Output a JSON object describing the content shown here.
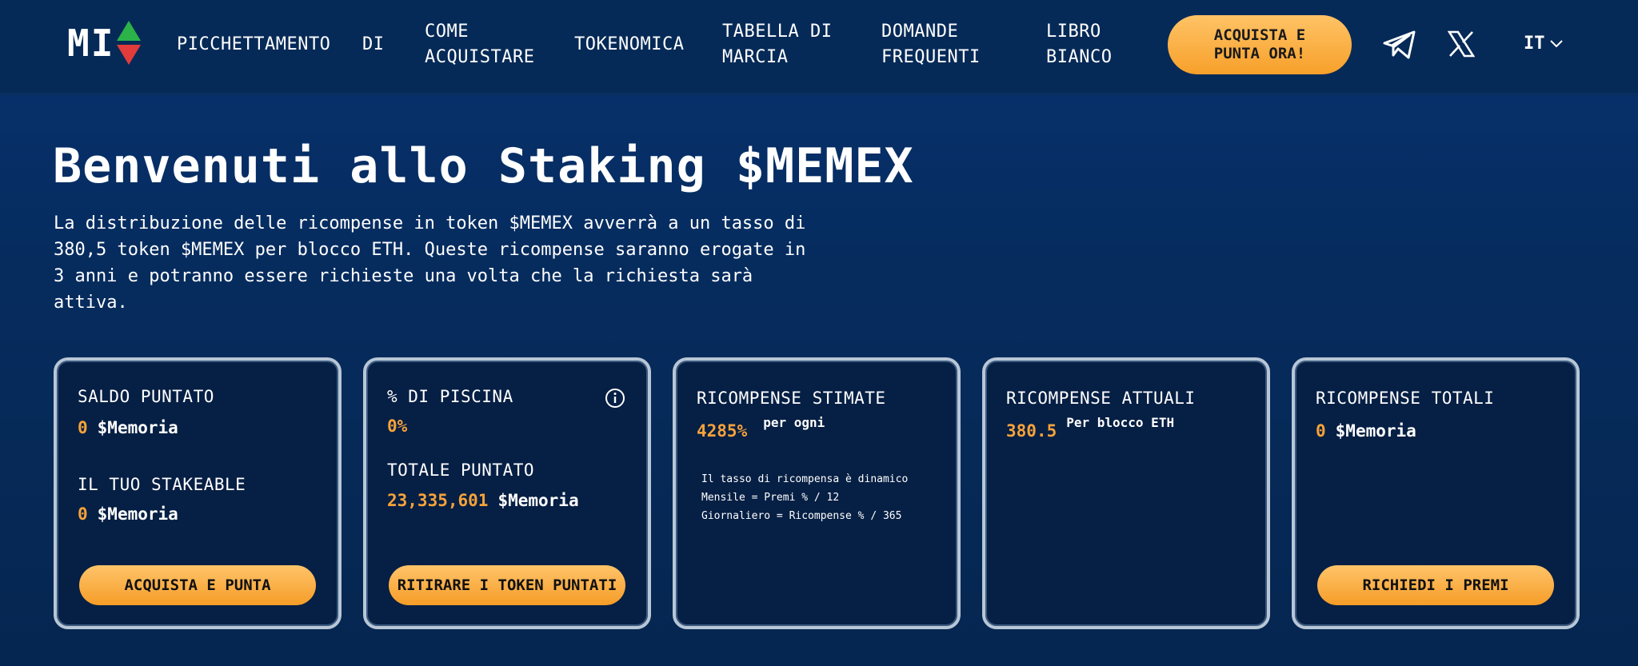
{
  "nav": {
    "logo_text": "MI",
    "items": [
      {
        "label": "PICCHETTAMENTO"
      },
      {
        "label": "DI"
      },
      {
        "label": "COME ACQUISTARE"
      },
      {
        "label": "TOKENOMICA"
      },
      {
        "label": "TABELLA DI MARCIA"
      },
      {
        "label": "DOMANDE FREQUENTI"
      },
      {
        "label": "LIBRO BIANCO"
      }
    ],
    "cta_label": "ACQUISTA E PUNTA ORA!",
    "language": "IT",
    "icons": [
      "telegram-icon",
      "x-icon"
    ]
  },
  "hero": {
    "title": "Benvenuti allo Staking $MEMEX",
    "intro": "La distribuzione delle ricompense in token $MEMEX avverrà a un tasso di 380,5 token $MEMEX per blocco ETH. Queste ricompense saranno erogate in 3 anni e potranno essere richieste una volta che la richiesta sarà attiva."
  },
  "cards": {
    "staked": {
      "label": "SALDO PUNTATO",
      "value": "0",
      "unit": "$Memoria",
      "stakeable_label": "IL TUO STAKEABLE",
      "stakeable_value": "0",
      "stakeable_unit": "$Memoria",
      "button": "ACQUISTA E PUNTA"
    },
    "pool": {
      "label": "% DI PISCINA",
      "value": "0%",
      "total_label": "TOTALE PUNTATO",
      "total_value": "23,335,601",
      "total_unit": "$Memoria",
      "button": "RITIRARE I TOKEN PUNTATI"
    },
    "estimated": {
      "label": "RICOMPENSE STIMATE",
      "value": "4285%",
      "suffix": "per ogni",
      "note_1": "Il tasso di ricompensa è dinamico",
      "note_2": "Mensile = Premi % / 12",
      "note_3": "Giornaliero = Ricompense % / 365"
    },
    "current": {
      "label": "RICOMPENSE ATTUALI",
      "value": "380.5",
      "suffix": "Per blocco ETH"
    },
    "total": {
      "label": "RICOMPENSE TOTALI",
      "value": "0",
      "unit": "$Memoria",
      "button": "RICHIEDI I PREMI"
    }
  },
  "colors": {
    "background": "#062a55",
    "accent_orange": "#f6a33a",
    "card_bg": "#061f44",
    "card_border": "#b8c6d6"
  }
}
